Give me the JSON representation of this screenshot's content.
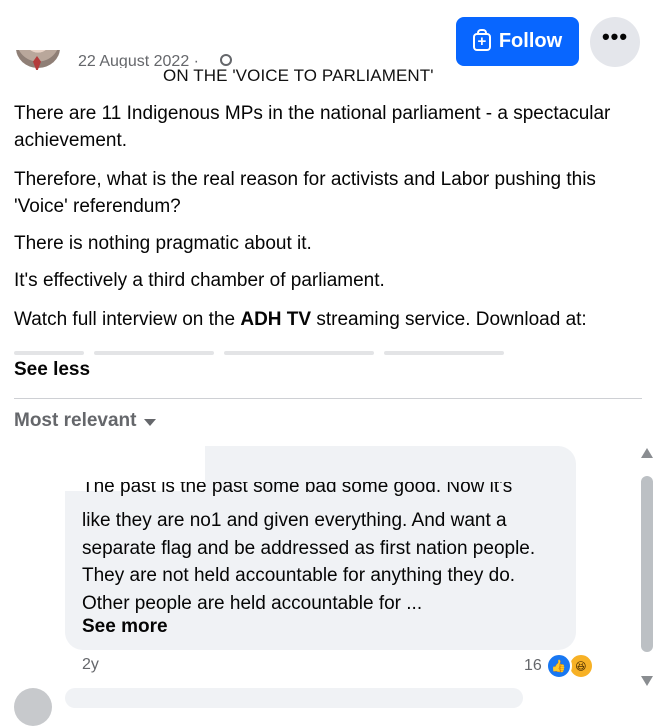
{
  "post": {
    "date": "22 August 2022 ·",
    "overlay_title": "ON THE 'VOICE TO PARLIAMENT'",
    "paragraphs": [
      "There are 11 Indigenous MPs in the national parliament - a spectacular achievement.",
      "Therefore, what is the real reason for activists and Labor pushing this 'Voice' referendum?",
      "There is nothing pragmatic about it.",
      "It's effectively a third chamber of parliament."
    ],
    "watch_prefix": "Watch full interview on the ",
    "watch_brand": "ADH TV",
    "watch_suffix": " streaming service. Download at:",
    "see_less": "See less"
  },
  "header": {
    "follow_label": "Follow",
    "more_label": "•••"
  },
  "comments": {
    "sort_label": "Most relevant",
    "first": {
      "first_line": "The past is the past some bad some good. Now it's",
      "text": "like they are no1 and given everything. And want a separate flag and be addressed as first nation people. They are not held accountable for anything they do. Other people are held accountable for ...",
      "see_more": "See more",
      "age": "2y",
      "reaction_count": "16",
      "reactions": [
        "like-icon",
        "haha-icon"
      ]
    }
  },
  "colors": {
    "accent": "#0866ff",
    "bubble": "#f0f2f5",
    "muted_text": "#65676b"
  }
}
